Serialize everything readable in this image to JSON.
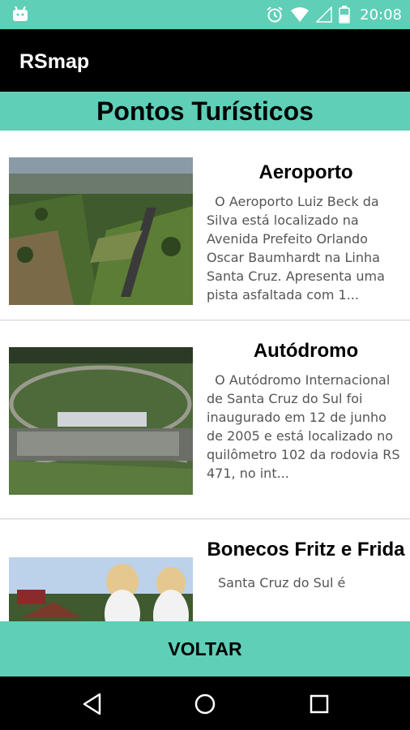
{
  "status_bar": {
    "time": "20:08",
    "icons": [
      "android-icon",
      "alarm-icon",
      "wifi-icon",
      "signal-icon",
      "battery-icon"
    ]
  },
  "app_bar": {
    "title": "RSmap"
  },
  "header": {
    "title": "Pontos Turísticos"
  },
  "places": [
    {
      "name": "Aeroporto",
      "description": "  O Aeroporto Luiz Beck da Silva está localizado na Avenida Prefeito Orlando Oscar Baumhardt na Linha Santa Cruz. Apresenta uma pista asfaltada com 1...",
      "image": "aerial-airport-photo"
    },
    {
      "name": "Autódromo",
      "description": "  O Autódromo Internacional de Santa Cruz do Sul foi inaugurado em 12 de junho de 2005 e está localizado no quilômetro 102 da rodovia RS 471, no int...",
      "image": "aerial-racetrack-photo"
    },
    {
      "name": "Bonecos Fritz e Frida",
      "description": "Santa Cruz do Sul é",
      "image": "fritz-frida-dolls-photo"
    }
  ],
  "footer": {
    "back_label": "VOLTAR"
  },
  "nav_bar": {
    "icons": [
      "back-icon",
      "home-icon",
      "recents-icon"
    ]
  },
  "colors": {
    "accent": "#5fcfb7",
    "app_bar": "#000000",
    "text_secondary": "#555555"
  }
}
